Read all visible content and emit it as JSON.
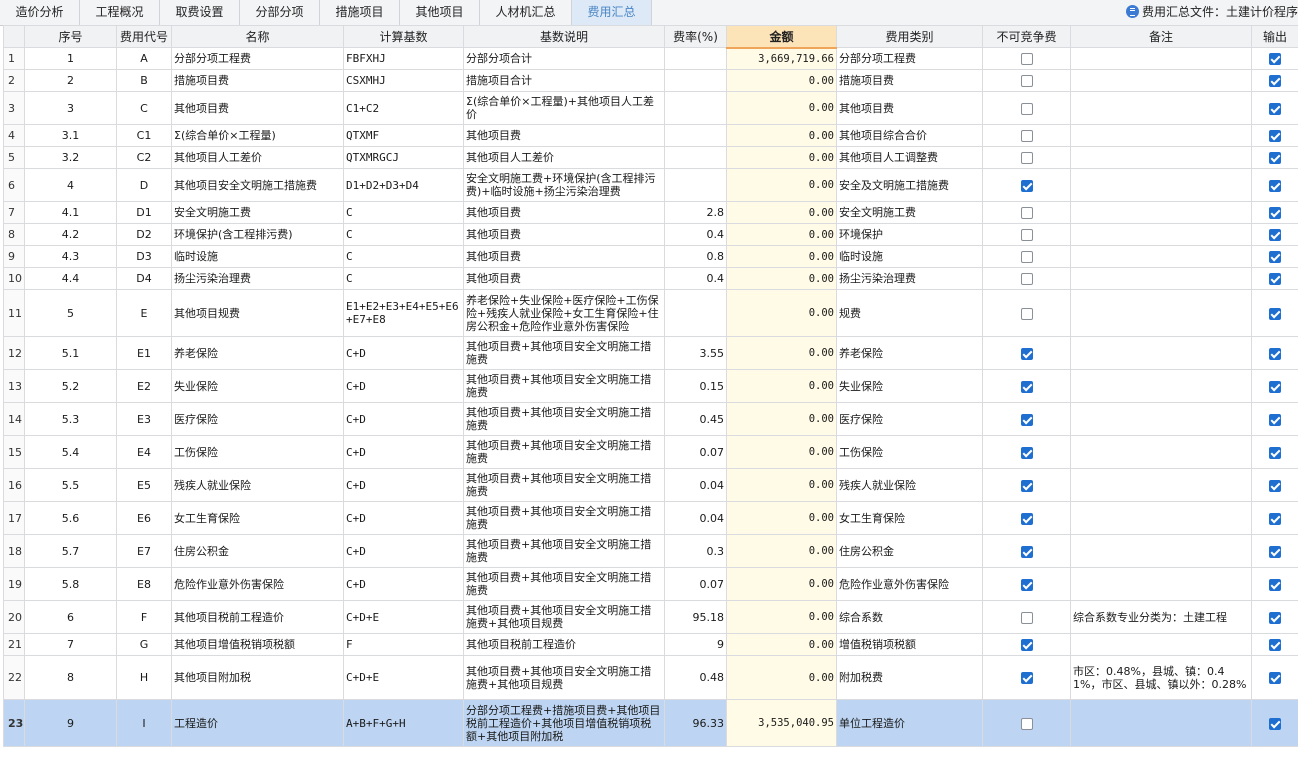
{
  "tabs": [
    "造价分析",
    "工程概况",
    "取费设置",
    "分部分项",
    "措施项目",
    "其他项目",
    "人材机汇总",
    "费用汇总"
  ],
  "active_tab": 7,
  "file_label": "费用汇总文件：土建计价程序",
  "columns": [
    "",
    "序号",
    "费用代号",
    "名称",
    "计算基数",
    "基数说明",
    "费率(%)",
    "金额",
    "费用类别",
    "不可竞争费",
    "备注",
    "输出"
  ],
  "rows": [
    {
      "n": "1",
      "seq": "1",
      "code": "A",
      "name": "分部分项工程费",
      "base": "FBFXHJ",
      "desc": "分部分项合计",
      "rate": "",
      "amount": "3,669,719.66",
      "cat": "分部分项工程费",
      "nc": false,
      "note": "",
      "out": true
    },
    {
      "n": "2",
      "seq": "2",
      "code": "B",
      "name": "措施项目费",
      "base": "CSXMHJ",
      "desc": "措施项目合计",
      "rate": "",
      "amount": "0.00",
      "cat": "措施项目费",
      "nc": false,
      "note": "",
      "out": true
    },
    {
      "n": "3",
      "seq": "3",
      "code": "C",
      "name": "其他项目费",
      "base": "C1+C2",
      "desc": "Σ(综合单价×工程量)+其他项目人工差价",
      "rate": "",
      "amount": "0.00",
      "cat": "其他项目费",
      "nc": false,
      "note": "",
      "out": true
    },
    {
      "n": "4",
      "seq": "3.1",
      "code": "C1",
      "name": "Σ(综合单价×工程量)",
      "base": "QTXMF",
      "desc": "其他项目费",
      "rate": "",
      "amount": "0.00",
      "cat": "其他项目综合合价",
      "nc": false,
      "note": "",
      "out": true
    },
    {
      "n": "5",
      "seq": "3.2",
      "code": "C2",
      "name": "其他项目人工差价",
      "base": "QTXMRGCJ",
      "desc": "其他项目人工差价",
      "rate": "",
      "amount": "0.00",
      "cat": "其他项目人工调整费",
      "nc": false,
      "note": "",
      "out": true
    },
    {
      "n": "6",
      "seq": "4",
      "code": "D",
      "name": "其他项目安全文明施工措施费",
      "base": "D1+D2+D3+D4",
      "desc": "安全文明施工费+环境保护(含工程排污费)+临时设施+扬尘污染治理费",
      "rate": "",
      "amount": "0.00",
      "cat": "安全及文明施工措施费",
      "nc": true,
      "note": "",
      "out": true
    },
    {
      "n": "7",
      "seq": "4.1",
      "code": "D1",
      "name": "安全文明施工费",
      "base": "C",
      "desc": "其他项目费",
      "rate": "2.8",
      "amount": "0.00",
      "cat": "安全文明施工费",
      "nc": false,
      "note": "",
      "out": true
    },
    {
      "n": "8",
      "seq": "4.2",
      "code": "D2",
      "name": "环境保护(含工程排污费)",
      "base": "C",
      "desc": "其他项目费",
      "rate": "0.4",
      "amount": "0.00",
      "cat": "环境保护",
      "nc": false,
      "note": "",
      "out": true
    },
    {
      "n": "9",
      "seq": "4.3",
      "code": "D3",
      "name": "临时设施",
      "base": "C",
      "desc": "其他项目费",
      "rate": "0.8",
      "amount": "0.00",
      "cat": "临时设施",
      "nc": false,
      "note": "",
      "out": true
    },
    {
      "n": "10",
      "seq": "4.4",
      "code": "D4",
      "name": "扬尘污染治理费",
      "base": "C",
      "desc": "其他项目费",
      "rate": "0.4",
      "amount": "0.00",
      "cat": "扬尘污染治理费",
      "nc": false,
      "note": "",
      "out": true
    },
    {
      "n": "11",
      "seq": "5",
      "code": "E",
      "name": "其他项目规费",
      "base": "E1+E2+E3+E4+E5+E6+E7+E8",
      "desc": "养老保险+失业保险+医疗保险+工伤保险+残疾人就业保险+女工生育保险+住房公积金+危险作业意外伤害保险",
      "rate": "",
      "amount": "0.00",
      "cat": "规费",
      "nc": false,
      "note": "",
      "out": true
    },
    {
      "n": "12",
      "seq": "5.1",
      "code": "E1",
      "name": "养老保险",
      "base": "C+D",
      "desc": "其他项目费+其他项目安全文明施工措施费",
      "rate": "3.55",
      "amount": "0.00",
      "cat": "养老保险",
      "nc": true,
      "note": "",
      "out": true
    },
    {
      "n": "13",
      "seq": "5.2",
      "code": "E2",
      "name": "失业保险",
      "base": "C+D",
      "desc": "其他项目费+其他项目安全文明施工措施费",
      "rate": "0.15",
      "amount": "0.00",
      "cat": "失业保险",
      "nc": true,
      "note": "",
      "out": true
    },
    {
      "n": "14",
      "seq": "5.3",
      "code": "E3",
      "name": "医疗保险",
      "base": "C+D",
      "desc": "其他项目费+其他项目安全文明施工措施费",
      "rate": "0.45",
      "amount": "0.00",
      "cat": "医疗保险",
      "nc": true,
      "note": "",
      "out": true
    },
    {
      "n": "15",
      "seq": "5.4",
      "code": "E4",
      "name": "工伤保险",
      "base": "C+D",
      "desc": "其他项目费+其他项目安全文明施工措施费",
      "rate": "0.07",
      "amount": "0.00",
      "cat": "工伤保险",
      "nc": true,
      "note": "",
      "out": true
    },
    {
      "n": "16",
      "seq": "5.5",
      "code": "E5",
      "name": "残疾人就业保险",
      "base": "C+D",
      "desc": "其他项目费+其他项目安全文明施工措施费",
      "rate": "0.04",
      "amount": "0.00",
      "cat": "残疾人就业保险",
      "nc": true,
      "note": "",
      "out": true
    },
    {
      "n": "17",
      "seq": "5.6",
      "code": "E6",
      "name": "女工生育保险",
      "base": "C+D",
      "desc": "其他项目费+其他项目安全文明施工措施费",
      "rate": "0.04",
      "amount": "0.00",
      "cat": "女工生育保险",
      "nc": true,
      "note": "",
      "out": true
    },
    {
      "n": "18",
      "seq": "5.7",
      "code": "E7",
      "name": "住房公积金",
      "base": "C+D",
      "desc": "其他项目费+其他项目安全文明施工措施费",
      "rate": "0.3",
      "amount": "0.00",
      "cat": "住房公积金",
      "nc": true,
      "note": "",
      "out": true
    },
    {
      "n": "19",
      "seq": "5.8",
      "code": "E8",
      "name": "危险作业意外伤害保险",
      "base": "C+D",
      "desc": "其他项目费+其他项目安全文明施工措施费",
      "rate": "0.07",
      "amount": "0.00",
      "cat": "危险作业意外伤害保险",
      "nc": true,
      "note": "",
      "out": true
    },
    {
      "n": "20",
      "seq": "6",
      "code": "F",
      "name": "其他项目税前工程造价",
      "base": "C+D+E",
      "desc": "其他项目费+其他项目安全文明施工措施费+其他项目规费",
      "rate": "95.18",
      "amount": "0.00",
      "cat": "综合系数",
      "nc": false,
      "note": "综合系数专业分类为：土建工程",
      "out": true
    },
    {
      "n": "21",
      "seq": "7",
      "code": "G",
      "name": "其他项目增值税销项税额",
      "base": "F",
      "desc": "其他项目税前工程造价",
      "rate": "9",
      "amount": "0.00",
      "cat": "增值税销项税额",
      "nc": true,
      "note": "",
      "out": true
    },
    {
      "n": "22",
      "seq": "8",
      "code": "H",
      "name": "其他项目附加税",
      "base": "C+D+E",
      "desc": "其他项目费+其他项目安全文明施工措施费+其他项目规费",
      "rate": "0.48",
      "amount": "0.00",
      "cat": "附加税费",
      "nc": true,
      "note": "市区：0.48%，县城、镇：0.41%，市区、县城、镇以外：0.28%",
      "out": true
    },
    {
      "n": "23",
      "seq": "9",
      "code": "I",
      "name": "工程造价",
      "base": "A+B+F+G+H",
      "desc": "分部分项工程费+措施项目费+其他项目税前工程造价+其他项目增值税销项税额+其他项目附加税",
      "rate": "96.33",
      "amount": "3,535,040.95",
      "cat": "单位工程造价",
      "nc": false,
      "note": "",
      "out": true,
      "selected": true
    }
  ]
}
